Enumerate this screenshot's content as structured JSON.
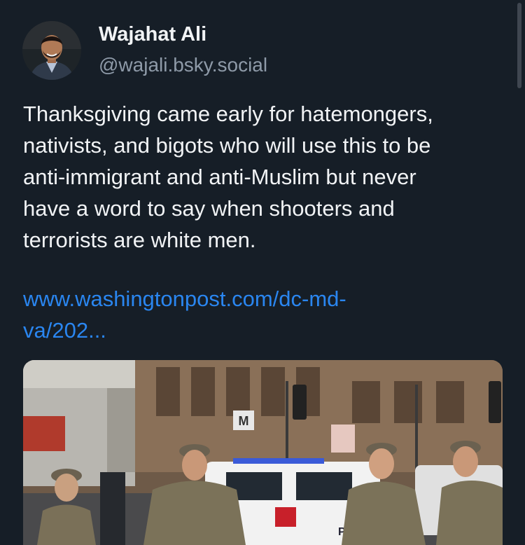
{
  "post": {
    "author": {
      "display_name": "Wajahat Ali",
      "handle": "@wajali.bsky.social"
    },
    "text_lines": [
      "Thanksgiving came early for hatemongers,",
      "nativists, and bigots who will use this to be",
      "anti-immigrant and anti-Muslim but never",
      "have a word to say when shooters and",
      "terrorists are white men."
    ],
    "link_lines": [
      "www.washingtonpost.com/dc-md-",
      "va/202..."
    ],
    "image": {
      "sign_text": "M",
      "vehicle_text": "PO"
    }
  },
  "colors": {
    "background": "#161e27",
    "text": "#f1f3f5",
    "handle": "#8e9aa8",
    "link": "#2a86f0"
  }
}
